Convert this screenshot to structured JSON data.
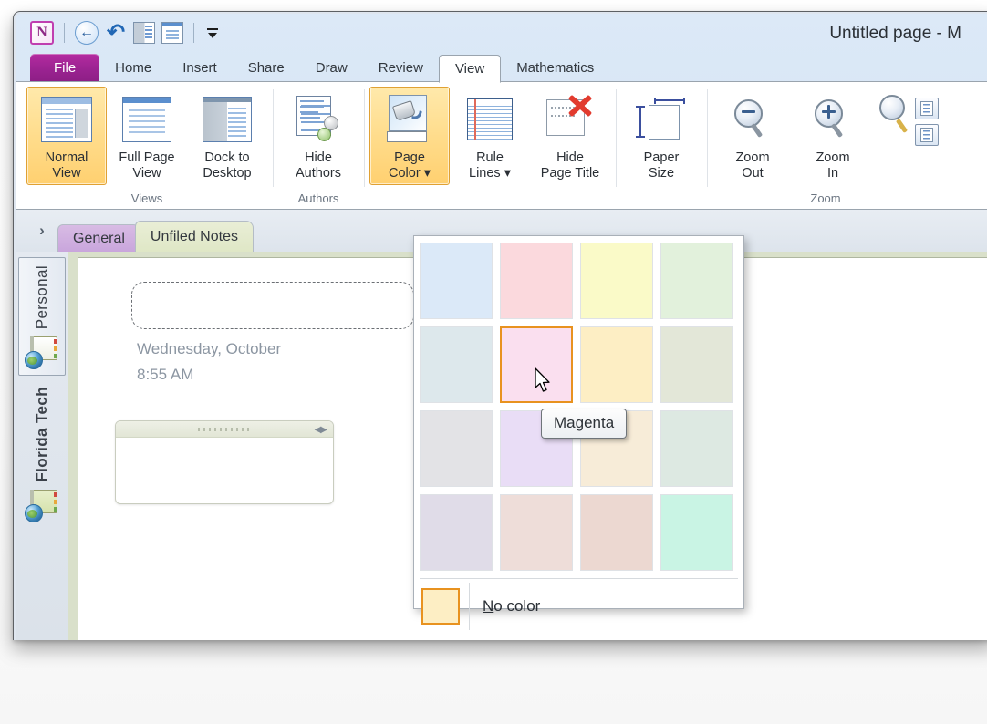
{
  "window": {
    "title": "Untitled page  -  M",
    "quick_access": [
      {
        "name": "onenote-logo-icon",
        "label": "OneNote"
      },
      {
        "name": "back-icon",
        "label": "Back"
      },
      {
        "name": "undo-icon",
        "label": "Undo"
      },
      {
        "name": "dock-to-desktop-icon",
        "label": "Dock to Desktop"
      },
      {
        "name": "full-page-view-icon",
        "label": "Full Page View"
      },
      {
        "name": "customize-quick-access-icon",
        "label": "Customize Quick Access Toolbar"
      }
    ]
  },
  "ribbon": {
    "tabs": [
      {
        "label": "File",
        "active": false,
        "file": true
      },
      {
        "label": "Home",
        "active": false
      },
      {
        "label": "Insert",
        "active": false
      },
      {
        "label": "Share",
        "active": false
      },
      {
        "label": "Draw",
        "active": false
      },
      {
        "label": "Review",
        "active": false
      },
      {
        "label": "View",
        "active": true
      },
      {
        "label": "Mathematics",
        "active": false
      }
    ],
    "groups": [
      {
        "label": "Views",
        "buttons": [
          {
            "label_line1": "Normal",
            "label_line2": "View",
            "icon": "normal-view-icon",
            "selected": true
          },
          {
            "label_line1": "Full Page",
            "label_line2": "View",
            "icon": "full-page-view-icon",
            "selected": false
          },
          {
            "label_line1": "Dock to",
            "label_line2": "Desktop",
            "icon": "dock-to-desktop-icon",
            "selected": false
          }
        ]
      },
      {
        "label": "Authors",
        "buttons": [
          {
            "label_line1": "Hide",
            "label_line2": "Authors",
            "icon": "hide-authors-icon",
            "selected": false
          }
        ]
      },
      {
        "label": "",
        "buttons": [
          {
            "label_line1": "Page",
            "label_line2": "Color ▾",
            "icon": "page-color-icon",
            "selected": true
          },
          {
            "label_line1": "Rule",
            "label_line2": "Lines ▾",
            "icon": "rule-lines-icon",
            "selected": false
          },
          {
            "label_line1": "Hide",
            "label_line2": "Page Title",
            "icon": "hide-page-title-icon",
            "selected": false
          }
        ]
      },
      {
        "label": "",
        "buttons": [
          {
            "label_line1": "Paper",
            "label_line2": "Size",
            "icon": "paper-size-icon",
            "selected": false
          }
        ]
      },
      {
        "label": "Zoom",
        "buttons": [
          {
            "label_line1": "Zoom",
            "label_line2": "Out",
            "icon": "zoom-out-icon",
            "selected": false
          },
          {
            "label_line1": "Zoom",
            "label_line2": "In",
            "icon": "zoom-in-icon",
            "selected": false
          }
        ]
      }
    ]
  },
  "section_tabs": [
    {
      "label": "General",
      "active": false,
      "color": "#c9a6dc"
    },
    {
      "label": "Unfiled Notes",
      "active": true,
      "color": "#dfe7c6"
    }
  ],
  "nav_expand_icon": "›",
  "notebooks": [
    {
      "label": "Personal",
      "active": true,
      "bold": false
    },
    {
      "label": "Florida Tech",
      "active": false,
      "bold": true
    }
  ],
  "page": {
    "title_placeholder": "",
    "date": "Wednesday, October",
    "time": "8:55 AM"
  },
  "page_color_menu": {
    "no_color_label_prefix": "",
    "no_color_label": "No color",
    "no_color_accesskey": "N",
    "no_color_rest": "o color",
    "selected_swatch_border": "#e8921f",
    "tooltip": "Magenta",
    "rows": [
      [
        {
          "name": "blue",
          "hex": "#dbe9f8"
        },
        {
          "name": "pink",
          "hex": "#fbd9dd"
        },
        {
          "name": "yellow",
          "hex": "#fafac8"
        },
        {
          "name": "green",
          "hex": "#e2f1dc"
        }
      ],
      [
        {
          "name": "cyan",
          "hex": "#dde8ec"
        },
        {
          "name": "magenta",
          "hex": "#fadfef",
          "hovered": true
        },
        {
          "name": "tan",
          "hex": "#fdeec4"
        },
        {
          "name": "olive",
          "hex": "#e3e7d8"
        }
      ],
      [
        {
          "name": "gray",
          "hex": "#e3e3e6"
        },
        {
          "name": "purple",
          "hex": "#e9ddf6"
        },
        {
          "name": "apricot",
          "hex": "#f7ecd8"
        },
        {
          "name": "teal",
          "hex": "#dde9e2"
        }
      ],
      [
        {
          "name": "lavender",
          "hex": "#e0dce8"
        },
        {
          "name": "rose",
          "hex": "#eeddd9"
        },
        {
          "name": "salmon",
          "hex": "#ecd8d1"
        },
        {
          "name": "mint",
          "hex": "#c9f4e4"
        }
      ]
    ]
  }
}
